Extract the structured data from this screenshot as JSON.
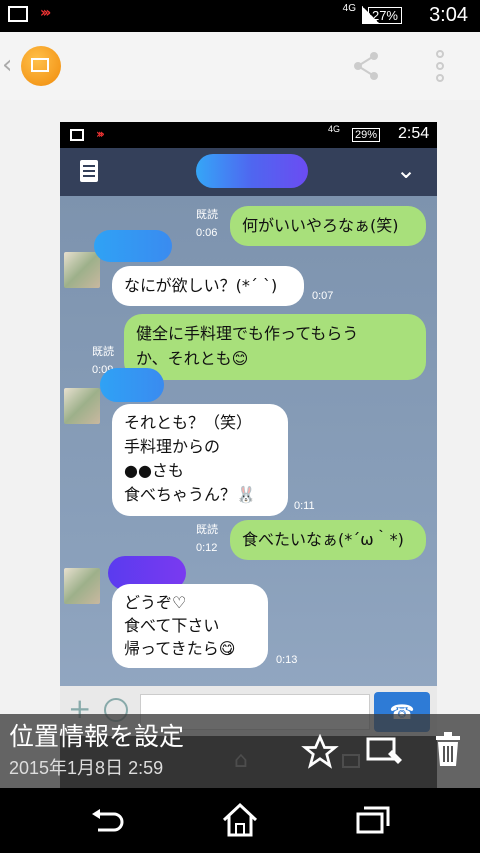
{
  "status_bar": {
    "time": "3:04",
    "battery": "27%",
    "network": "4G"
  },
  "screenshot": {
    "status_bar": {
      "time": "2:54",
      "battery": "29%",
      "network": "4G"
    },
    "messages": [
      {
        "side": "right",
        "text": "何がいいやろなぁ(笑)",
        "read_label": "既読",
        "time": "0:06"
      },
      {
        "side": "left",
        "text": "なにが欲しい？(*´ `)",
        "time": "0:07"
      },
      {
        "side": "right",
        "lines": [
          "健全に手料理でも作ってもらう",
          "か、それとも😊"
        ],
        "read_label": "既読",
        "time": "0:09"
      },
      {
        "side": "left",
        "lines": [
          "それとも？（笑）",
          "手料理からの",
          "●●さも",
          "食べちゃうん？🐰"
        ],
        "time": "0:11"
      },
      {
        "side": "right",
        "text": "食べたいなぁ(*´ω｀*)",
        "read_label": "既読",
        "time": "0:12"
      },
      {
        "side": "left",
        "lines": [
          "どうぞ♡",
          "食べて下さい",
          "帰ってきたら😋"
        ],
        "time": "0:13"
      }
    ]
  },
  "info": {
    "location_label": "位置情報を設定",
    "date": "2015年1月8日 2:59"
  },
  "icons": {
    "back": "chevron-left-icon",
    "app": "gallery-icon",
    "share": "share-icon",
    "menu": "more-vert-icon",
    "favorite": "star-icon",
    "edit": "edit-icon",
    "delete": "trash-icon",
    "nav_back": "back-arrow-icon",
    "nav_home": "home-icon",
    "nav_recents": "recents-icon"
  },
  "colors": {
    "accent": "#f5a623",
    "bubble_green": "#a8e07b",
    "chat_header": "#34405a"
  }
}
